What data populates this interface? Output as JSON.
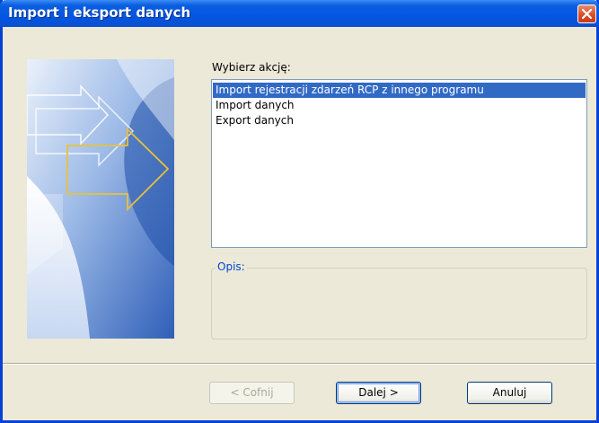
{
  "window": {
    "title": "Import i eksport danych"
  },
  "main": {
    "action_label": "Wybierz akcję:",
    "actions": [
      {
        "label": "Import rejestracji zdarzeń RCP z innego programu",
        "selected": true
      },
      {
        "label": "Import danych",
        "selected": false
      },
      {
        "label": "Export danych",
        "selected": false
      }
    ],
    "description_title": "Opis:",
    "description_text": ""
  },
  "buttons": {
    "back": "< Cofnij",
    "next": "Dalej >",
    "cancel": "Anuluj"
  },
  "colors": {
    "titlebar": "#0456e2",
    "selection": "#316ac5",
    "group_title": "#0046d5"
  }
}
